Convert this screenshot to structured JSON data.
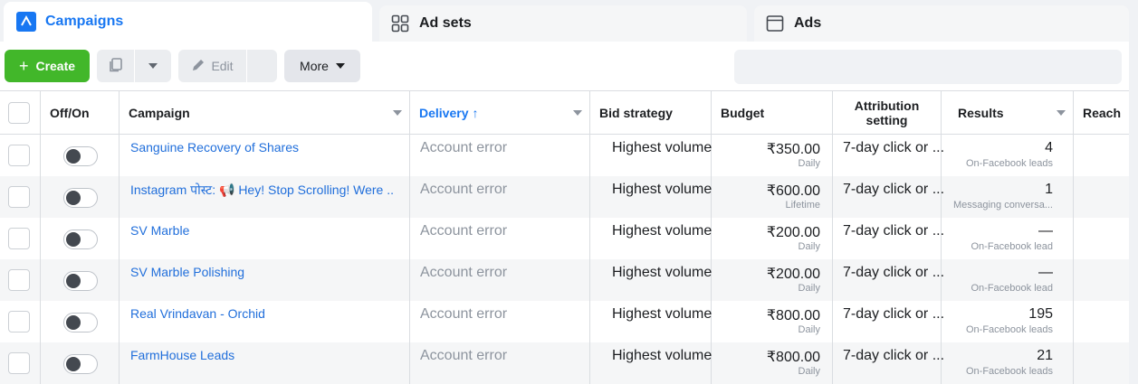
{
  "tabs": [
    {
      "label": "Campaigns",
      "icon": "campaign-icon",
      "active": true
    },
    {
      "label": "Ad sets",
      "icon": "grid-icon",
      "active": false
    },
    {
      "label": "Ads",
      "icon": "ad-window-icon",
      "active": false
    }
  ],
  "toolbar": {
    "create_label": "Create",
    "edit_label": "Edit",
    "more_label": "More",
    "search_placeholder": ""
  },
  "columns": {
    "off_on": "Off/On",
    "campaign": "Campaign",
    "delivery": "Delivery",
    "delivery_sort_arrow": "↑",
    "bid_strategy": "Bid strategy",
    "budget": "Budget",
    "attribution": "Attribution setting",
    "results": "Results",
    "reach": "Reach"
  },
  "rows": [
    {
      "campaign": "Sanguine Recovery of Shares",
      "delivery": "Account error",
      "bid": "Highest volume",
      "budget": "₹350.00",
      "budget_type": "Daily",
      "attribution": "7-day click or ...",
      "result": "4",
      "result_type": "On-Facebook leads"
    },
    {
      "campaign": "Instagram पोस्ट: 📢 Hey! Stop Scrolling! Were ...",
      "delivery": "Account error",
      "bid": "Highest volume",
      "budget": "₹600.00",
      "budget_type": "Lifetime",
      "attribution": "7-day click or ...",
      "result": "1",
      "result_type": "Messaging conversa..."
    },
    {
      "campaign": "SV Marble",
      "delivery": "Account error",
      "bid": "Highest volume",
      "budget": "₹200.00",
      "budget_type": "Daily",
      "attribution": "7-day click or ...",
      "result": "—",
      "result_type": "On-Facebook lead"
    },
    {
      "campaign": "SV Marble Polishing",
      "delivery": "Account error",
      "bid": "Highest volume",
      "budget": "₹200.00",
      "budget_type": "Daily",
      "attribution": "7-day click or ...",
      "result": "—",
      "result_type": "On-Facebook lead"
    },
    {
      "campaign": "Real Vrindavan - Orchid",
      "delivery": "Account error",
      "bid": "Highest volume",
      "budget": "₹800.00",
      "budget_type": "Daily",
      "attribution": "7-day click or ...",
      "result": "195",
      "result_type": "On-Facebook leads"
    },
    {
      "campaign": "FarmHouse Leads",
      "delivery": "Account error",
      "bid": "Highest volume",
      "budget": "₹800.00",
      "budget_type": "Daily",
      "attribution": "7-day click or ...",
      "result": "21",
      "result_type": "On-Facebook leads"
    }
  ],
  "colors": {
    "accent": "#1877f2",
    "create": "#42b72a",
    "link": "#216fdb"
  }
}
